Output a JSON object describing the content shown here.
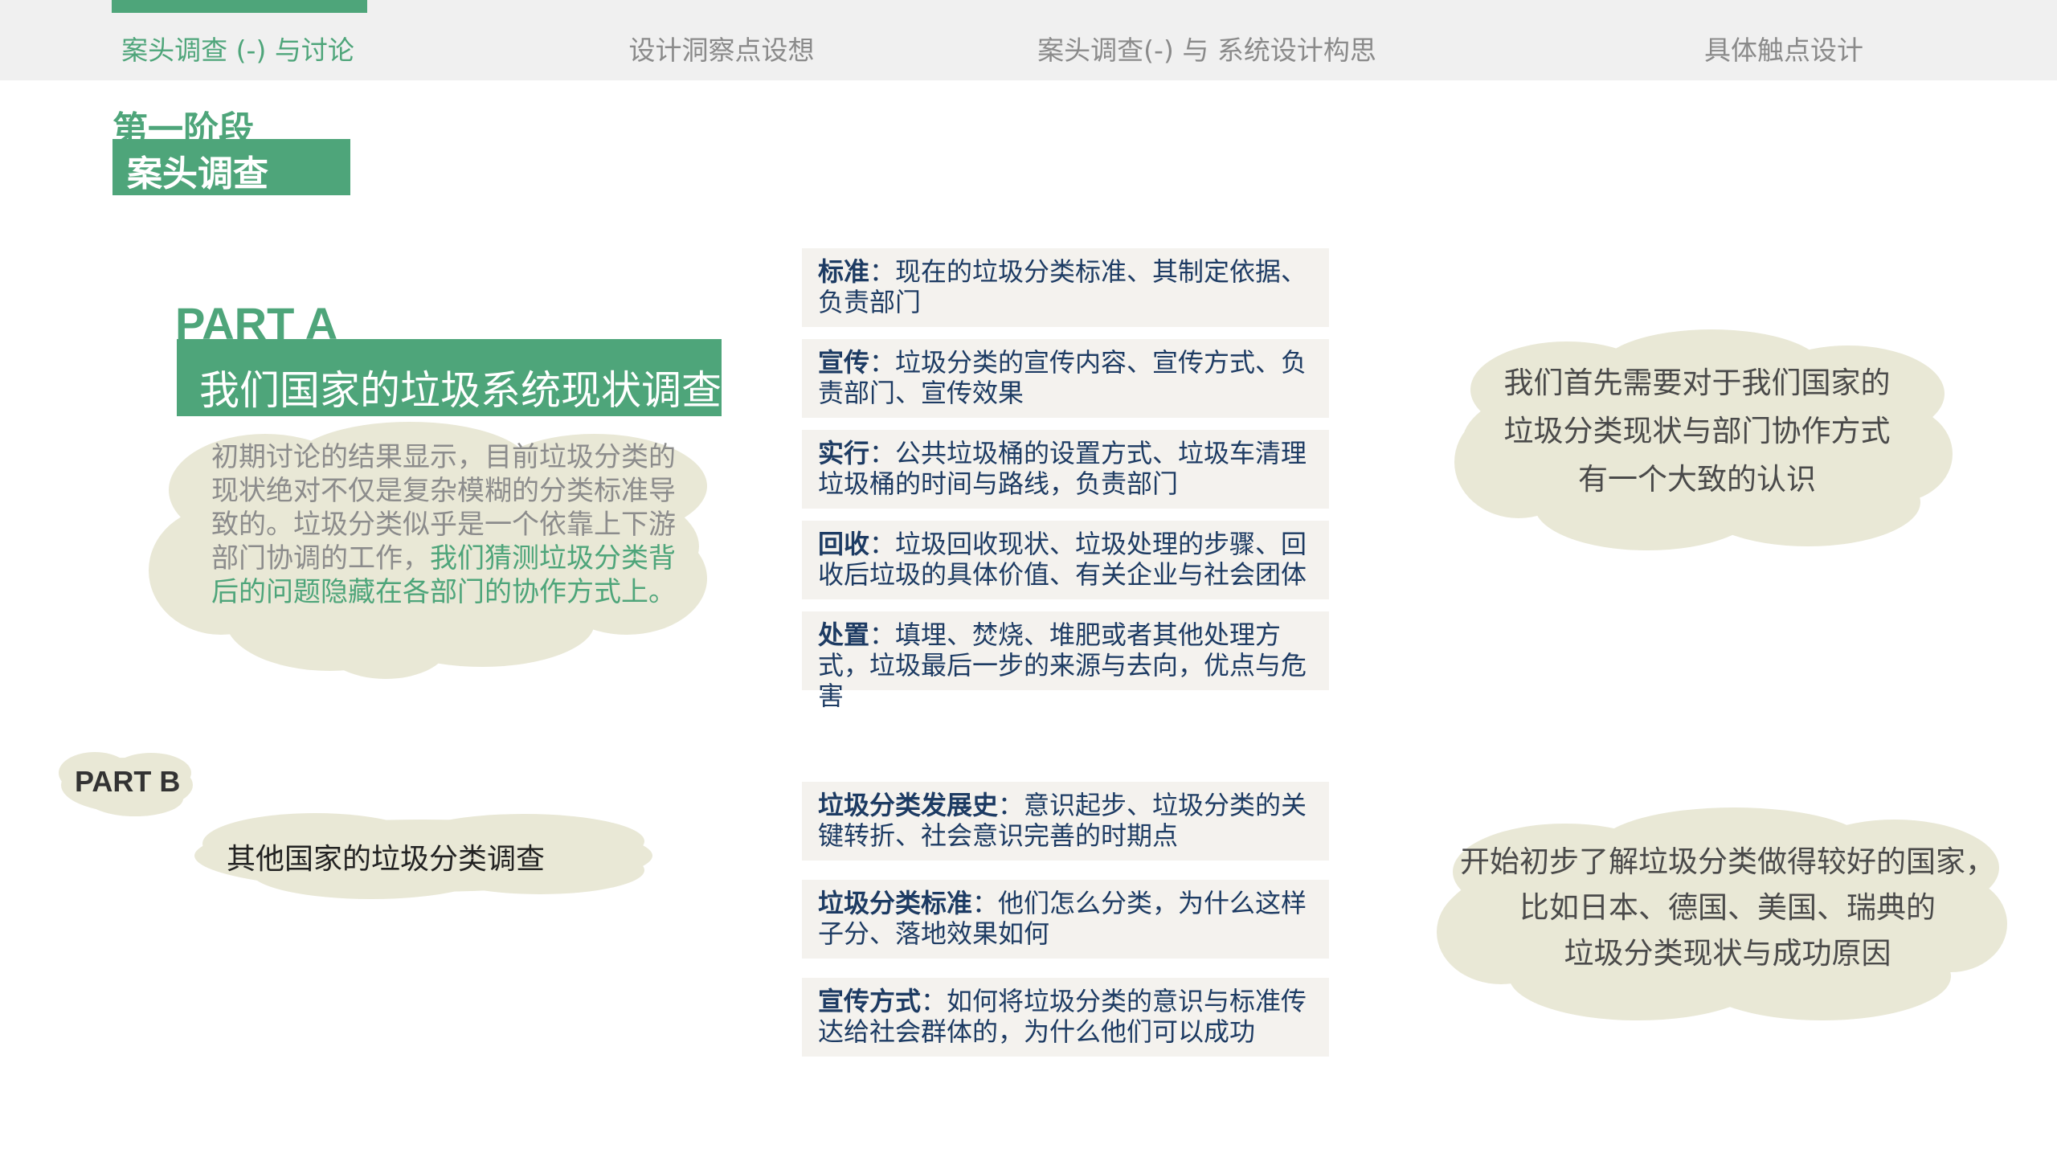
{
  "nav": {
    "tabs": [
      {
        "label": "案头调查 (-) 与讨论",
        "active": true
      },
      {
        "label": "设计洞察点设想",
        "active": false
      },
      {
        "label": "案头调查(-) 与 系统设计构思",
        "active": false
      },
      {
        "label": "具体触点设计",
        "active": false
      }
    ]
  },
  "stage": {
    "title": "第一阶段",
    "subtitle": "案头调查"
  },
  "part_a": {
    "title": "PART A",
    "subtitle": "我们国家的垃圾系统现状调查",
    "paragraph_normal": "初期讨论的结果显示，目前垃圾分类的现状绝对不仅是复杂模糊的分类标准导致的。垃圾分类似乎是一个依靠上下游部门协调的工作，",
    "paragraph_highlight": "我们猜测垃圾分类背后的问题隐藏在各部门的协作方式上。",
    "cards": [
      {
        "term": "标准",
        "text": "：现在的垃圾分类标准、其制定依据、负责部门"
      },
      {
        "term": "宣传",
        "text": "：垃圾分类的宣传内容、宣传方式、负责部门、宣传效果"
      },
      {
        "term": "实行",
        "text": "：公共垃圾桶的设置方式、垃圾车清理垃圾桶的时间与路线，负责部门"
      },
      {
        "term": "回收",
        "text": "：垃圾回收现状、垃圾处理的步骤、回收后垃圾的具体价值、有关企业与社会团体"
      },
      {
        "term": "处置",
        "text": "：填埋、焚烧、堆肥或者其他处理方式，垃圾最后一步的来源与去向，优点与危害"
      }
    ],
    "note_lines": [
      "我们首先需要对于我们国家的",
      "垃圾分类现状与部门协作方式",
      "有一个大致的认识"
    ]
  },
  "part_b": {
    "title": "PART B",
    "subtitle": "其他国家的垃圾分类调查",
    "cards": [
      {
        "term": "垃圾分类发展史",
        "text": "：意识起步、垃圾分类的关键转折、社会意识完善的时期点"
      },
      {
        "term": "垃圾分类标准",
        "text": "：他们怎么分类，为什么这样子分、落地效果如何"
      },
      {
        "term": "宣传方式",
        "text": "：如何将垃圾分类的意识与标准传达给社会群体的，为什么他们可以成功"
      }
    ],
    "note_lines": [
      "开始初步了解垃圾分类做得较好的国家，",
      "比如日本、德国、美国、瑞典的",
      "垃圾分类现状与成功原因"
    ]
  },
  "colors": {
    "accent_green": "#4ea57a",
    "card_text": "#1d3b63",
    "cloud": "#e9e8d6",
    "nav_bg": "#f0f0f0"
  }
}
